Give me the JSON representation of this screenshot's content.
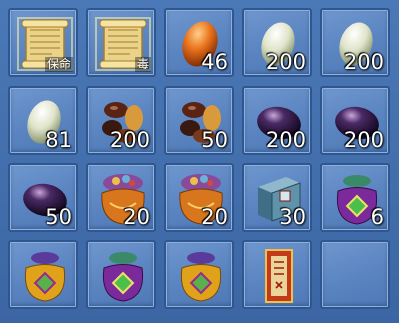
{
  "inventory": {
    "slots": [
      {
        "icon": "scroll-icon",
        "label": "保命",
        "count": ""
      },
      {
        "icon": "scroll-icon",
        "label": "毒",
        "count": ""
      },
      {
        "icon": "orange-egg-icon",
        "label": "",
        "count": "46"
      },
      {
        "icon": "white-egg-icon",
        "label": "",
        "count": "200"
      },
      {
        "icon": "white-egg-icon",
        "label": "",
        "count": "200"
      },
      {
        "icon": "white-egg-icon",
        "label": "",
        "count": "81"
      },
      {
        "icon": "nuts-icon",
        "label": "",
        "count": "200"
      },
      {
        "icon": "nuts-icon",
        "label": "",
        "count": "50"
      },
      {
        "icon": "dark-egg-icon",
        "label": "",
        "count": "200"
      },
      {
        "icon": "dark-egg-icon",
        "label": "",
        "count": "200"
      },
      {
        "icon": "dark-egg-icon",
        "label": "",
        "count": "50"
      },
      {
        "icon": "orange-pouch-icon",
        "label": "",
        "count": "20"
      },
      {
        "icon": "orange-pouch-icon",
        "label": "",
        "count": "20"
      },
      {
        "icon": "book-icon",
        "label": "",
        "count": "30"
      },
      {
        "icon": "purple-pouch-icon",
        "label": "",
        "count": "6"
      },
      {
        "icon": "gold-pouch-icon",
        "label": "",
        "count": ""
      },
      {
        "icon": "purple-pouch-icon",
        "label": "",
        "count": ""
      },
      {
        "icon": "gold-pouch-icon",
        "label": "",
        "count": ""
      },
      {
        "icon": "talisman-icon",
        "label": "",
        "count": ""
      },
      {
        "icon": "",
        "label": "",
        "count": ""
      }
    ]
  }
}
